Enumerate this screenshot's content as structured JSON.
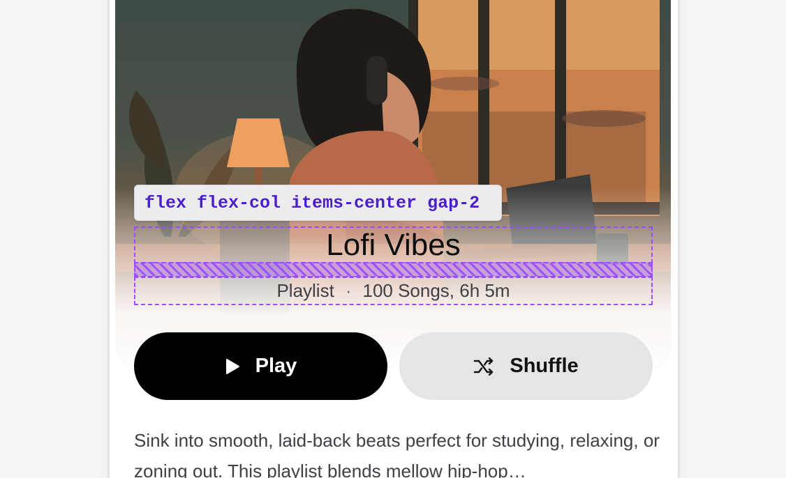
{
  "class_tag": "flex flex-col items-center gap-2",
  "playlist": {
    "title": "Lofi Vibes",
    "type": "Playlist",
    "separator": "·",
    "stats": "100 Songs, 6h 5m",
    "description": "Sink into smooth, laid-back beats perfect for studying, relaxing, or zoning out. This playlist blends mellow hip-hop…"
  },
  "actions": {
    "play_label": "Play",
    "shuffle_label": "Shuffle"
  },
  "icons": {
    "play": "play-icon",
    "shuffle": "shuffle-icon"
  },
  "colors": {
    "accent_dashed": "#9a4dff",
    "tag_text": "#4a1fc9",
    "play_bg": "#000000",
    "shuffle_bg": "#e5e5e5"
  }
}
